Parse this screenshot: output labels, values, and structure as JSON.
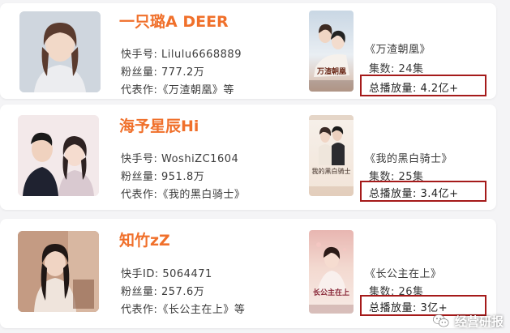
{
  "creators": [
    {
      "name": "一只璐A DEER",
      "id_label": "快手号: ",
      "id_value": "Lilulu6668889",
      "fans_label": "粉丝量: ",
      "fans_value": "777.2万",
      "works_line": "代表作:《万渣朝凰》等",
      "poster_title": "万渣朝凰",
      "drama_title": "《万渣朝凰》",
      "episodes": "集数: 24集",
      "plays": "总播放量: 4.2亿+"
    },
    {
      "name": "海予星辰Hi",
      "id_label": "快手号: ",
      "id_value": "WoshiZC1604",
      "fans_label": "粉丝量: ",
      "fans_value": "951.8万",
      "works_line": "代表作:《我的黑白骑士》",
      "poster_title": "我的黑白骑士",
      "drama_title": "《我的黑白骑士》",
      "episodes": "集数: 25集",
      "plays": "总播放量: 3.4亿+"
    },
    {
      "name": "知竹zZ",
      "id_label": "快手ID: ",
      "id_value": "5064471",
      "fans_label": "粉丝量: ",
      "fans_value": "257.6万",
      "works_line": "代表作:《长公主在上》等",
      "poster_title": "长公主在上",
      "drama_title": "《长公主在上》",
      "episodes": "集数: 26集",
      "plays": "总播放量: 3亿+"
    }
  ],
  "watermark": {
    "text": "经营研报",
    "icon": "wechat-icon"
  }
}
